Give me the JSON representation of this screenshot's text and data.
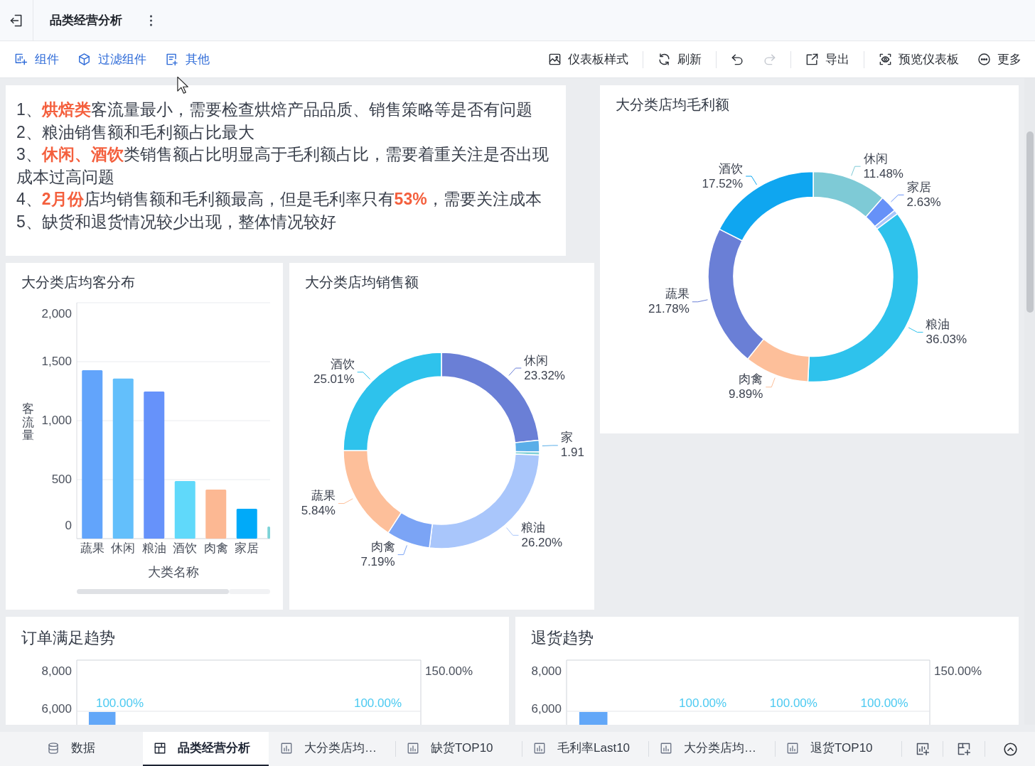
{
  "header": {
    "title": "品类经营分析"
  },
  "toolbar": {
    "left": [
      {
        "label": "组件"
      },
      {
        "label": "过滤组件"
      },
      {
        "label": "其他"
      }
    ],
    "right": [
      [
        {
          "kind": "labeled",
          "label": "仪表板样式",
          "disabled": false
        }
      ],
      [
        {
          "kind": "labeled",
          "label": "刷新",
          "disabled": false
        }
      ],
      [
        {
          "kind": "icon",
          "disabled": false
        },
        {
          "kind": "icon",
          "disabled": true
        }
      ],
      [
        {
          "kind": "labeled",
          "label": "导出",
          "disabled": false
        }
      ],
      [
        {
          "kind": "labeled",
          "label": "预览仪表板",
          "disabled": false
        },
        {
          "kind": "labeled",
          "label": "更多",
          "disabled": false
        }
      ]
    ]
  },
  "insights": {
    "lines": [
      "1、**烘焙类**客流量最小，需要检查烘焙产品品质、销售策略等是否有问题",
      "2、粮油销售额和毛利额占比最大",
      "3、**休闲、酒饮**类销售额占比明显高于毛利额占比，需要着重关注是否出现成本过高问题",
      "4、**2月份**店均销售额和毛利额最高，但是毛利率只有**53%**，需要关注成本",
      "5、缺货和退货情况较少出现，整体情况较好"
    ]
  },
  "traffic_card": {
    "title": "大分类店均客分布",
    "chart_data": {
      "type": "bar",
      "xlabel": "大类名称",
      "ylabel": "客流量",
      "categories": [
        "蔬果",
        "休闲",
        "粮油",
        "酒饮",
        "肉禽",
        "家居",
        null
      ],
      "series": [
        {
          "colors": [
            "#62a4fb",
            "#63bffb",
            "#6692fa",
            "#60d9fa",
            "#fcb893",
            "#00aaf9",
            "#7cd3d8"
          ],
          "values": [
            1428,
            1357,
            1247,
            488,
            416,
            253,
            102
          ]
        }
      ],
      "ylim": [
        0,
        2000
      ],
      "yticks": [
        {
          "value": 0,
          "label": "0"
        },
        {
          "value": 500,
          "label": "500"
        },
        {
          "value": 1000,
          "label": "1,000"
        },
        {
          "value": 1500,
          "label": "1,500"
        },
        {
          "value": 2000,
          "label": "2,000"
        }
      ],
      "grid": true
    }
  },
  "sales_card": {
    "title": "大分类店均销售额",
    "chart_data": {
      "type": "donut",
      "categories": [
        "休闲",
        "家",
        null,
        "粮油",
        "肉禽",
        "蔬果",
        "酒饮"
      ],
      "series": [
        {
          "colors": [
            "#6a7fd6",
            "#5aaee8",
            "#7fd0d8",
            "#a9c6fb",
            "#7ba4f5",
            "#fdbf9a",
            "#2ec2ec"
          ],
          "values": [
            23.32,
            1.91,
            0.53,
            26.2,
            7.19,
            15.84,
            25.01
          ]
        }
      ],
      "value_labels": [
        "23.32%",
        "1.91",
        null,
        "26.20%",
        "7.19%",
        "5.84%",
        "25.01%"
      ]
    }
  },
  "profit_card": {
    "title": "大分类店均毛利额",
    "chart_data": {
      "type": "donut",
      "categories": [
        "休闲",
        "家居",
        null,
        "粮油",
        "肉禽",
        "蔬果",
        "酒饮"
      ],
      "series": [
        {
          "colors": [
            "#7ecad6",
            "#6691f8",
            "#a9c6fb",
            "#2ec2ec",
            "#fdbf9a",
            "#6a7fd6",
            "#0fa6f0"
          ],
          "values": [
            11.48,
            2.63,
            0.67,
            36.03,
            9.89,
            21.78,
            17.52
          ]
        }
      ],
      "value_labels": [
        "11.48%",
        "2.63%",
        null,
        "36.03%",
        "9.89%",
        "21.78%",
        "17.52%"
      ]
    }
  },
  "trend_cards": [
    {
      "title": "订单满足趋势",
      "left_ticks": [
        "8,000",
        "6,000"
      ],
      "right_ticks": [
        "150.00%"
      ],
      "point_labels": [
        "100.00%",
        "100.00%"
      ]
    },
    {
      "title": "退货趋势",
      "left_ticks": [
        "8,000",
        "6,000"
      ],
      "right_ticks": [
        "150.00%"
      ],
      "point_labels": [
        "100.00%",
        "100.00%",
        "100.00%"
      ]
    }
  ],
  "tabs": [
    {
      "kind": "data",
      "label": "数据",
      "selected": false
    },
    {
      "kind": "dashboard",
      "label": "品类经营分析",
      "selected": true
    },
    {
      "kind": "chart",
      "label": "大分类店均…",
      "selected": false
    },
    {
      "kind": "chart",
      "label": "缺货TOP10",
      "selected": false
    },
    {
      "kind": "chart",
      "label": "毛利率Last10",
      "selected": false
    },
    {
      "kind": "chart",
      "label": "大分类店均…",
      "selected": false
    },
    {
      "kind": "chart",
      "label": "退货TOP10",
      "selected": false
    }
  ]
}
